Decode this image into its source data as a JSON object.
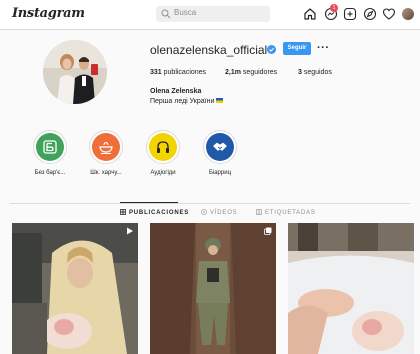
{
  "app": {
    "logo": "Instagram"
  },
  "search": {
    "placeholder": "Busca"
  },
  "nav": {
    "notifications_count": "1"
  },
  "profile": {
    "username": "olenazelenska_official",
    "follow_label": "Seguir",
    "more_label": "···",
    "stats": {
      "posts_count": "331",
      "posts_label": "publicaciones",
      "followers_count": "2,1m",
      "followers_label": "seguidores",
      "following_count": "3",
      "following_label": "seguidos"
    },
    "full_name": "Olena Zelenska",
    "bio": "Перша леді України"
  },
  "highlights": [
    {
      "label": "Без бар'є...",
      "color": "#3fa35b",
      "icon": "barrier-free-icon"
    },
    {
      "label": "Шк. харчу...",
      "color": "#ef6f3a",
      "icon": "food-bowl-icon"
    },
    {
      "label": "Аудіогіди",
      "color": "#f4d400",
      "icon": "headphones-icon"
    },
    {
      "label": "Біарриц",
      "color": "#1f59a8",
      "icon": "handshake-icon"
    }
  ],
  "tabs": [
    {
      "label": "PUBLICACIONES",
      "active": true,
      "icon": "grid-icon"
    },
    {
      "label": "VÍDEOS",
      "active": false,
      "icon": "video-icon"
    },
    {
      "label": "ETIQUETADAS",
      "active": false,
      "icon": "tagged-icon"
    }
  ],
  "posts": [
    {
      "subject": "woman-holding-baby",
      "type": "video"
    },
    {
      "subject": "soldier-in-trench",
      "type": "carousel"
    },
    {
      "subject": "hands-touching-newborn",
      "type": "photo"
    }
  ],
  "colors": {
    "accent_blue": "#3897f0",
    "badge_red": "#ed4956",
    "border": "#dbdbdb",
    "text": "#262626",
    "muted": "#8e8e8e"
  }
}
